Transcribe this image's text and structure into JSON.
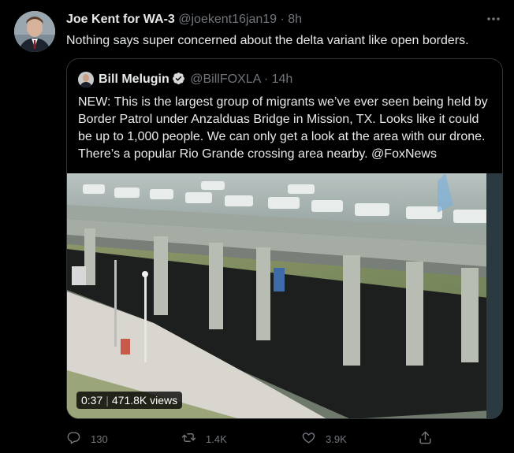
{
  "tweet": {
    "author_name": "Joe Kent for WA-3",
    "author_handle": "@joekent16jan19",
    "separator": "·",
    "time": "8h",
    "text": "Nothing says super concerned about the delta variant like open borders.",
    "more_icon": "more-icon"
  },
  "quoted": {
    "author_name": "Bill Melugin",
    "author_handle": "@BillFOXLA",
    "separator": "·",
    "time": "14h",
    "text": "NEW: This is the largest group of migrants we’ve ever seen being held by Border Patrol under Anzalduas Bridge in Mission, TX. Looks like it could be up to 1,000 people. We can only get a look at the area with our drone. There’s a popular Rio Grande crossing area nearby. @FoxNews",
    "verified_icon": "verified-icon",
    "video": {
      "duration": "0:37",
      "views": "471.8K views"
    }
  },
  "actions": {
    "reply_count": "130",
    "retweet_count": "1.4K",
    "like_count": "3.9K",
    "icons": [
      "reply-icon",
      "retweet-icon",
      "like-icon",
      "share-icon"
    ]
  },
  "colors": {
    "background": "#000000",
    "text": "#e7e9ea",
    "muted": "#71767b",
    "border": "#2f3336",
    "verified": "#d9d9d9"
  }
}
